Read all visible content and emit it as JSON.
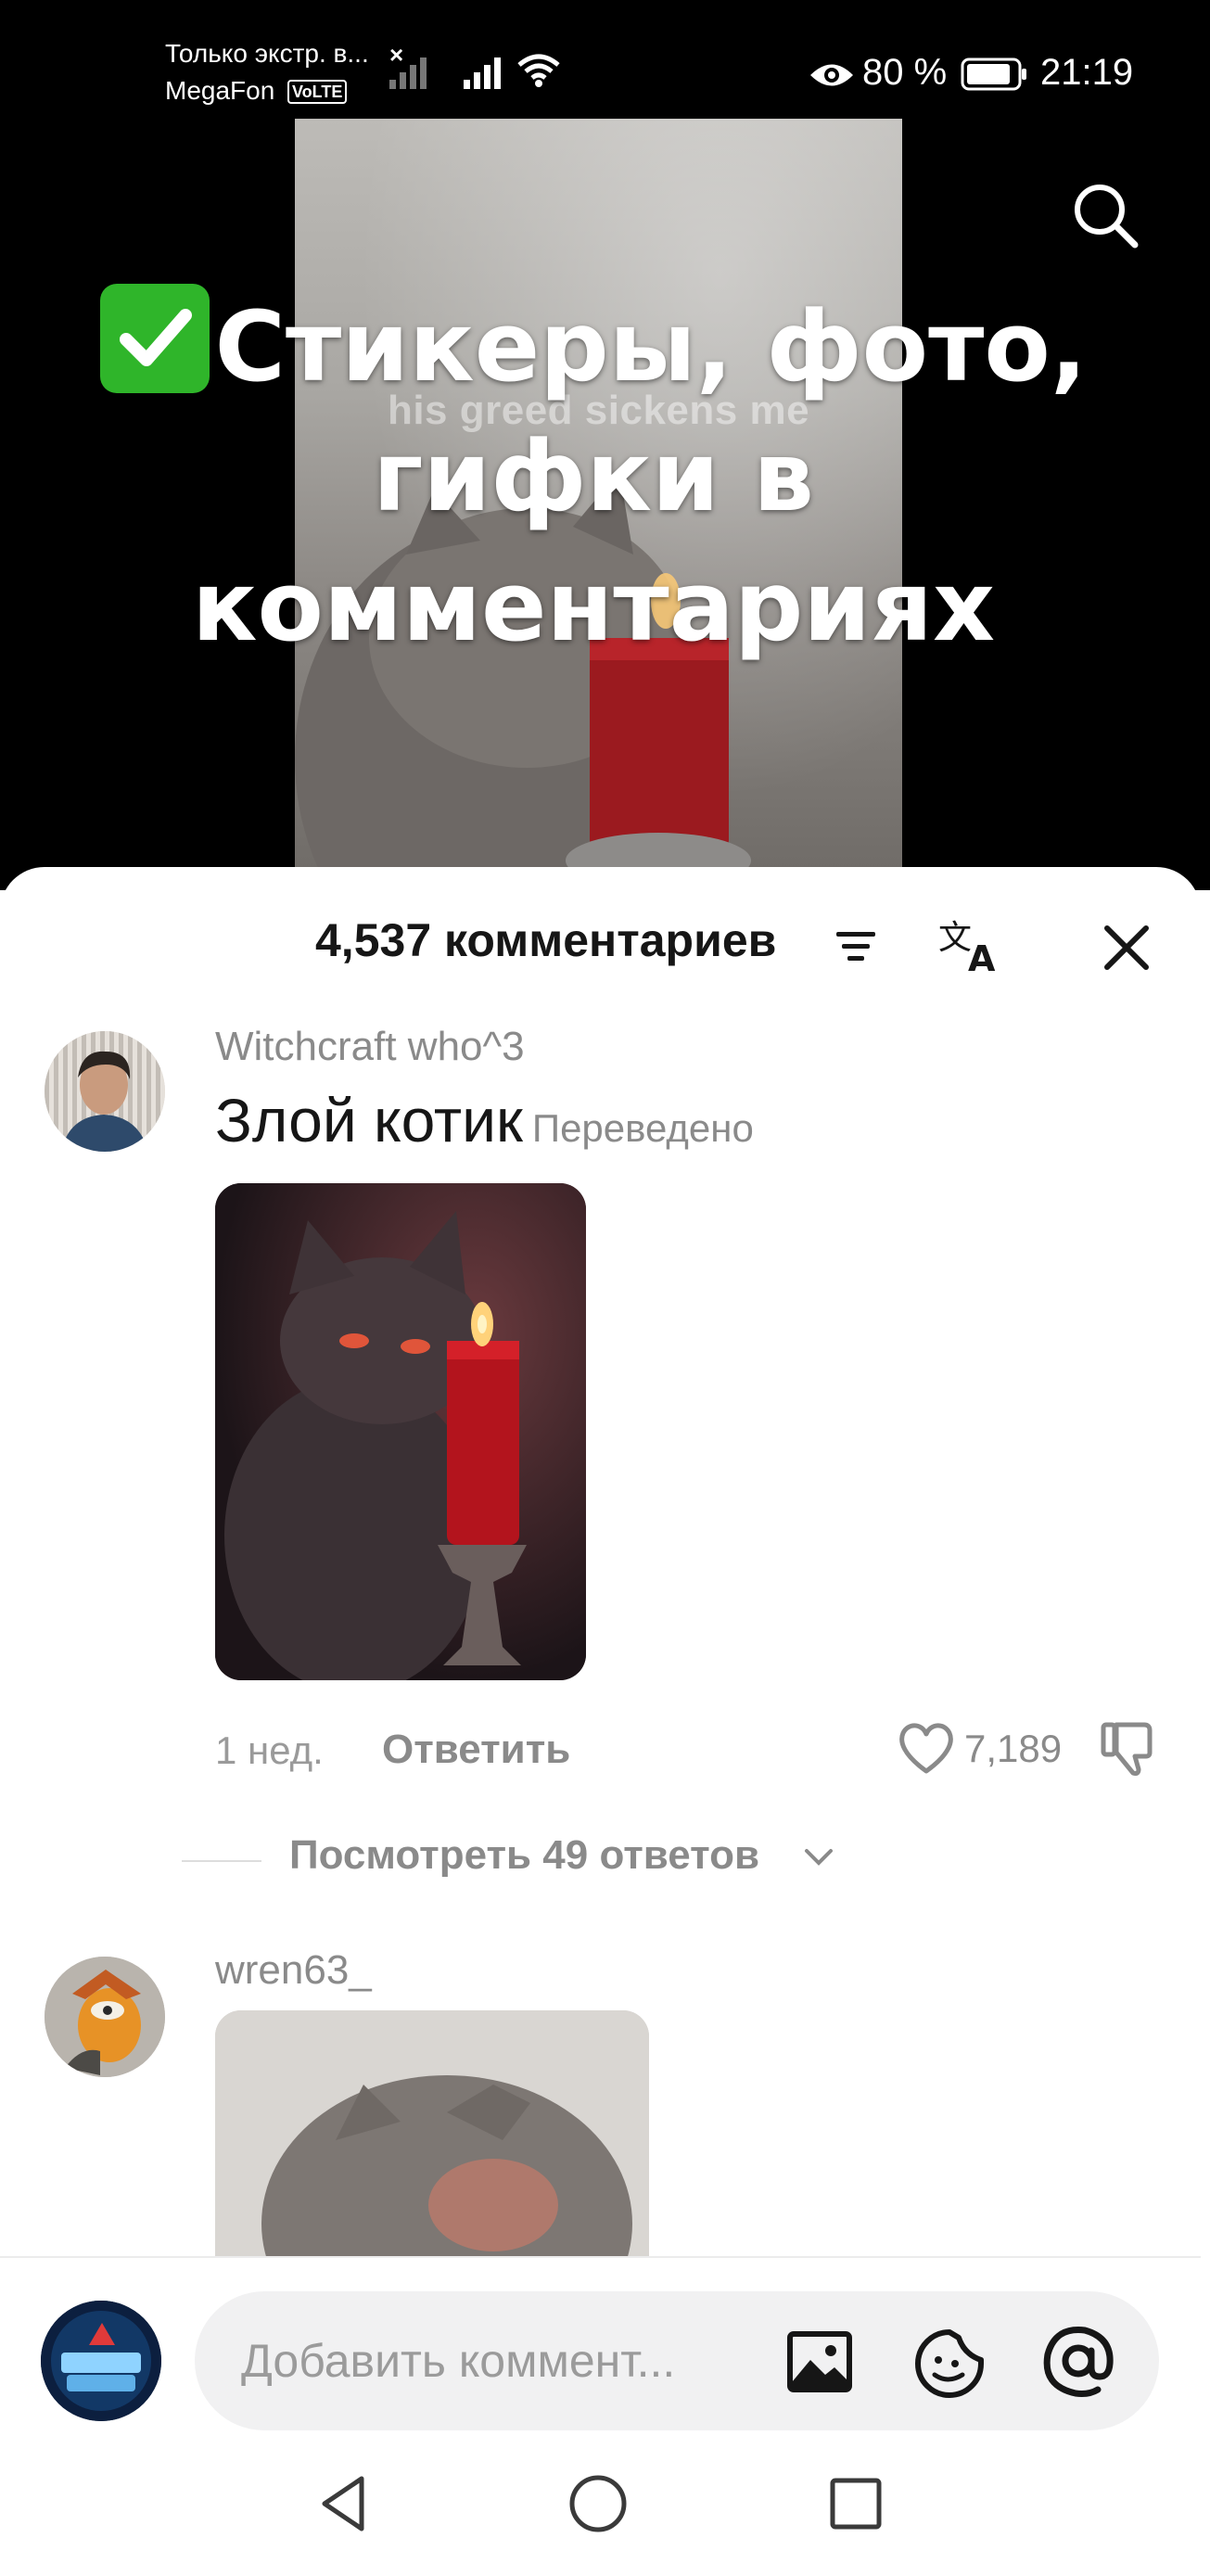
{
  "status_bar": {
    "carrier_1": "Только экстр. в...",
    "carrier_1_close": "×",
    "carrier_2": "MegaFon",
    "volte": "VoLTE",
    "battery": "80 %",
    "time": "21:19"
  },
  "video": {
    "caption": "his greed sickens me",
    "promo_title": "Стикеры, фото, гифки в комментариях"
  },
  "comments_header": {
    "count_label": "4,537 комментариев"
  },
  "comments": [
    {
      "username": "Witchcraft who^3",
      "text": "Злой котик",
      "translated_label": "Переведено",
      "age": "1 нед.",
      "reply_label": "Ответить",
      "likes": "7,189",
      "view_replies": "Посмотреть 49 ответов"
    },
    {
      "username": "wren63_"
    }
  ],
  "input": {
    "placeholder": "Добавить коммент..."
  },
  "icons": {
    "search": "search-icon",
    "sort": "sort-icon",
    "translate": "translate-icon",
    "close": "close-icon",
    "like": "heart-icon",
    "dislike": "thumbs-down-icon",
    "image": "image-icon",
    "emoji": "emoji-icon",
    "mention": "at-sign-icon"
  },
  "colors": {
    "accent_check": "#2fb52a",
    "text_primary": "#161616",
    "text_secondary": "#8a8a8a"
  }
}
